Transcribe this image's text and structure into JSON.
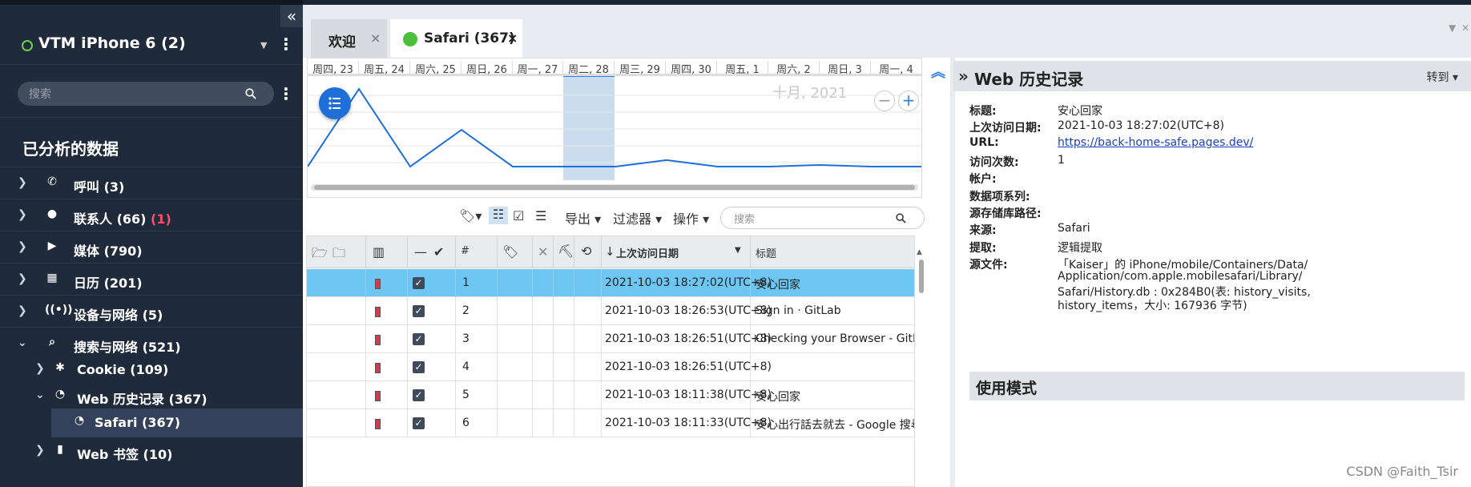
{
  "sidebar": {
    "device": {
      "title": "VTM iPhone 6 (2)",
      "status_color": "#6ad14e"
    },
    "search": {
      "placeholder": "搜索"
    },
    "section_title": "已分析的数据",
    "items": [
      {
        "label": "呼叫 (3)",
        "icon": "phone-icon",
        "expanded": false
      },
      {
        "label": "联系人 (66)",
        "badge": "(1)",
        "icon": "contacts-icon",
        "expanded": false
      },
      {
        "label": "媒体 (790)",
        "icon": "media-icon",
        "expanded": false
      },
      {
        "label": "日历 (201)",
        "icon": "calendar-icon",
        "expanded": false
      },
      {
        "label": "设备与网络 (5)",
        "icon": "network-icon",
        "expanded": false
      },
      {
        "label": "搜索与网络 (521)",
        "icon": "search-icon",
        "expanded": true
      },
      {
        "label": "Cookie (109)",
        "icon": "cookie-icon",
        "expanded": false
      },
      {
        "label": "Web 历史记录 (367)",
        "icon": "history-icon",
        "expanded": true
      },
      {
        "label": "Safari (367)",
        "icon": "history-icon",
        "selected": true
      },
      {
        "label": "Web 书签 (10)",
        "icon": "bookmark-icon",
        "expanded": false
      }
    ]
  },
  "tabs": [
    {
      "label": "欢迎",
      "close": "×"
    },
    {
      "label": "Safari (367)",
      "close": "×",
      "active": true
    }
  ],
  "timeline": {
    "days": [
      "周四, 23",
      "周五, 24",
      "周六, 25",
      "周日, 26",
      "周一, 27",
      "周二, 28",
      "周三, 29",
      "周四, 30",
      "周五, 1",
      "周六, 2",
      "周日, 3",
      "周一, 4"
    ],
    "month_label": "十月, 2021",
    "highlight_index": 5,
    "line_color": "#1e6fd9",
    "series_values": [
      0,
      95,
      0,
      45,
      0,
      0,
      0,
      8,
      0,
      0,
      2,
      0,
      0
    ]
  },
  "toolbar": {
    "export": "导出",
    "filter": "过滤器",
    "actions": "操作",
    "search_placeholder": "搜索"
  },
  "grid": {
    "col_number": "#",
    "col_date": "上次访问日期",
    "col_title": "标题",
    "rows": [
      {
        "num": "1",
        "date": "2021-10-03 18:27:02(UTC+8)",
        "title": "安心回家",
        "checked": true,
        "selected": true
      },
      {
        "num": "2",
        "date": "2021-10-03 18:26:53(UTC+8)",
        "title": "Sign in · GitLab",
        "checked": true
      },
      {
        "num": "3",
        "date": "2021-10-03 18:26:51(UTC+8)",
        "title": "Checking your Browser - GitLab",
        "checked": true
      },
      {
        "num": "4",
        "date": "2021-10-03 18:26:51(UTC+8)",
        "title": "",
        "checked": true
      },
      {
        "num": "5",
        "date": "2021-10-03 18:11:38(UTC+8)",
        "title": "安心回家",
        "checked": true
      },
      {
        "num": "6",
        "date": "2021-10-03 18:11:33(UTC+8)",
        "title": "安心出行話去就去 - Google 搜尋",
        "checked": true
      }
    ]
  },
  "detail": {
    "header": "Web 历史记录",
    "goto": "转到",
    "fields": [
      {
        "label": "标题:",
        "value": "安心回家"
      },
      {
        "label": "上次访问日期:",
        "value": "2021-10-03 18:27:02(UTC+8)"
      },
      {
        "label": "URL:",
        "value": "https://back-home-safe.pages.dev/",
        "link": true
      },
      {
        "label": "访问次数:",
        "value": "1"
      },
      {
        "label": "帐户:",
        "value": ""
      },
      {
        "label": "数据项系列:",
        "value": ""
      },
      {
        "label": "源存储库路径:",
        "value": ""
      },
      {
        "label": "来源:",
        "value": "Safari"
      },
      {
        "label": "提取:",
        "value": "逻辑提取"
      }
    ],
    "source_file_label": "源文件:",
    "source_file_lines": [
      "「Kaiser」的 iPhone/mobile/Containers/Data/",
      "Application/com.apple.mobilesafari/Library/",
      "Safari/History.db : 0x284B0(表: history_visits,",
      "history_items，大小: 167936 字节)"
    ],
    "usage_header": "使用模式"
  },
  "watermark": "CSDN @Faith_Tsir"
}
